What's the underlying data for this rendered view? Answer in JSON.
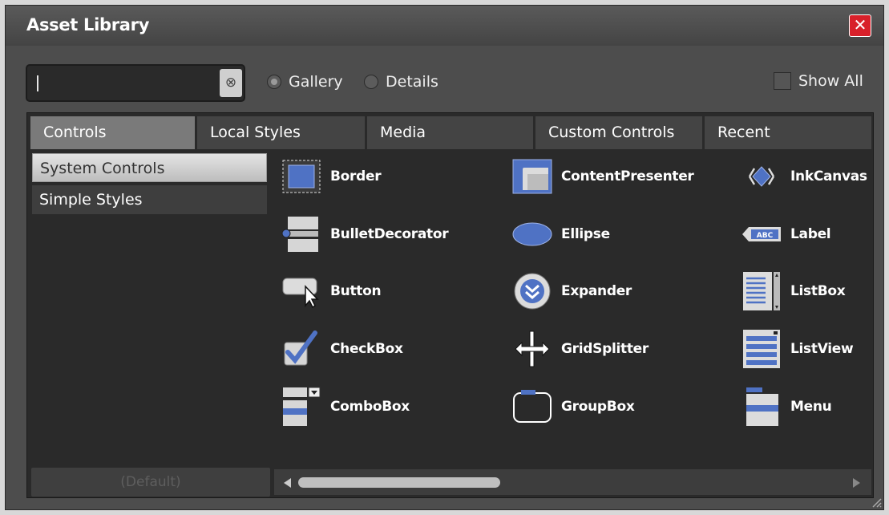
{
  "window": {
    "title": "Asset Library",
    "close_glyph": "✕"
  },
  "search": {
    "value": "",
    "clear_glyph": "⊗"
  },
  "view_mode": {
    "options": [
      "Gallery",
      "Details"
    ],
    "selected": "Gallery"
  },
  "show_all": {
    "label": "Show All",
    "checked": false
  },
  "tabs": [
    {
      "label": "Controls",
      "active": true
    },
    {
      "label": "Local Styles",
      "active": false
    },
    {
      "label": "Media",
      "active": false
    },
    {
      "label": "Custom Controls",
      "active": false
    },
    {
      "label": "Recent",
      "active": false
    }
  ],
  "categories": [
    {
      "label": "System Controls",
      "active": true
    },
    {
      "label": "Simple Styles",
      "active": false
    }
  ],
  "default_button": {
    "label": "(Default)"
  },
  "assets": [
    {
      "name": "Border",
      "icon": "border-icon"
    },
    {
      "name": "BulletDecorator",
      "icon": "bullet-decorator-icon"
    },
    {
      "name": "Button",
      "icon": "button-icon"
    },
    {
      "name": "CheckBox",
      "icon": "checkbox-icon"
    },
    {
      "name": "ComboBox",
      "icon": "combobox-icon"
    },
    {
      "name": "ContentPresenter",
      "icon": "content-presenter-icon"
    },
    {
      "name": "Ellipse",
      "icon": "ellipse-icon"
    },
    {
      "name": "Expander",
      "icon": "expander-icon"
    },
    {
      "name": "GridSplitter",
      "icon": "grid-splitter-icon"
    },
    {
      "name": "GroupBox",
      "icon": "group-box-icon"
    },
    {
      "name": "InkCanvas",
      "icon": "ink-canvas-icon"
    },
    {
      "name": "Label",
      "icon": "label-icon",
      "icon_text": "ABC"
    },
    {
      "name": "ListBox",
      "icon": "list-box-icon"
    },
    {
      "name": "ListView",
      "icon": "list-view-icon"
    },
    {
      "name": "Menu",
      "icon": "menu-icon"
    }
  ],
  "scroll": {
    "horizontal_position": 0
  },
  "colors": {
    "accent_blue": "#4f72c4",
    "close_red": "#d8202a",
    "panel_bg": "#2a2a2a",
    "window_bg": "#4d4d4d"
  }
}
